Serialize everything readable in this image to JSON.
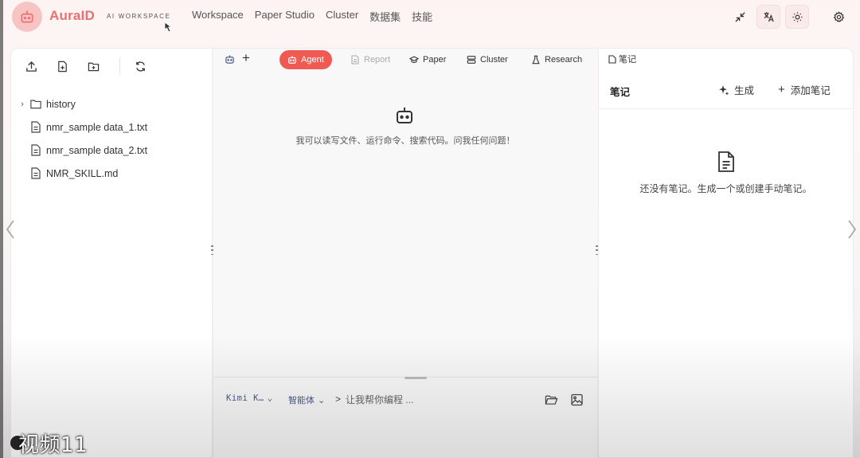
{
  "header": {
    "brand": "AuraID",
    "brand_sub": "AI WORKSPACE",
    "nav": [
      "Workspace",
      "Paper Studio",
      "Cluster",
      "数据集",
      "技能"
    ],
    "actions": [
      "minimize-icon",
      "translate-icon",
      "theme-icon",
      "settings-icon"
    ]
  },
  "file_panel": {
    "toolbar": [
      "upload-icon",
      "new-file-icon",
      "new-folder-icon",
      "refresh-icon"
    ],
    "items": [
      {
        "label": "history",
        "type": "folder"
      },
      {
        "label": "nmr_sample data_1.txt",
        "type": "file"
      },
      {
        "label": "nmr_sample data_2.txt",
        "type": "file"
      },
      {
        "label": "NMR_SKILL.md",
        "type": "file"
      }
    ]
  },
  "center": {
    "tabs": {
      "agent": "Agent",
      "report": "Report",
      "paper": "Paper",
      "cluster": "Cluster",
      "research": "Research"
    },
    "empty_message": "我可以读写文件、运行命令、搜索代码。问我任何问题！",
    "input": {
      "model": "Kimi K…",
      "mode": "智能体",
      "caret": ">",
      "placeholder": "让我帮你编程 ..."
    }
  },
  "notes": {
    "tab_label": "笔记",
    "title": "笔记",
    "generate_label": "生成",
    "add_label": "添加笔记",
    "empty_message": "还没有笔记。生成一个或创建手动笔记。"
  },
  "overlay": {
    "video_label": "视频11"
  },
  "colors": {
    "accent": "#ef5a52",
    "brand": "#ef6e6e",
    "logo_bg": "#f7c4c4"
  }
}
